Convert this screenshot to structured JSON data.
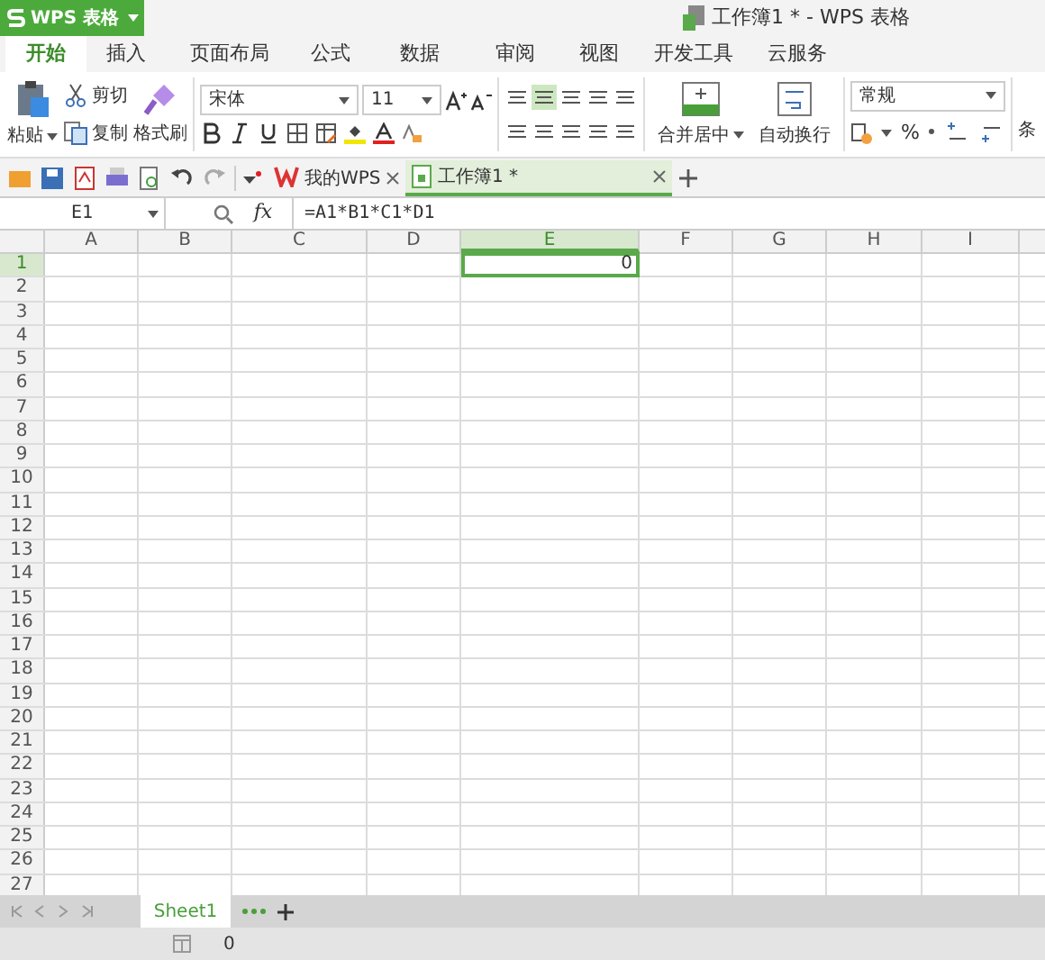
{
  "app_menu": {
    "label": "WPS 表格"
  },
  "window": {
    "title": "工作簿1 * - WPS 表格"
  },
  "ribbon_tabs": [
    {
      "label": "开始",
      "selected": true
    },
    {
      "label": "插入",
      "selected": false
    },
    {
      "label": "页面布局",
      "selected": false
    },
    {
      "label": "公式",
      "selected": false
    },
    {
      "label": "数据",
      "selected": false
    },
    {
      "label": "审阅",
      "selected": false
    },
    {
      "label": "视图",
      "selected": false
    },
    {
      "label": "开发工具",
      "selected": false
    },
    {
      "label": "云服务",
      "selected": false
    }
  ],
  "ribbon": {
    "paste": "粘贴",
    "cut": "剪切",
    "copy": "复制",
    "format_painter": "格式刷",
    "font_name": "宋体",
    "font_size": "11",
    "merge": "合并居中",
    "wrap": "自动换行",
    "number_format": "常规",
    "percent": "%",
    "cut_off_label": "条"
  },
  "doc_tabs": [
    {
      "label": "我的WPS",
      "selected": false
    },
    {
      "label": "工作簿1 *",
      "selected": true
    }
  ],
  "formula_bar": {
    "name_box": "E1",
    "fx": "fx",
    "formula": "=A1*B1*C1*D1"
  },
  "grid": {
    "columns": [
      {
        "label": "A",
        "selected": false
      },
      {
        "label": "B",
        "selected": false
      },
      {
        "label": "C",
        "selected": false
      },
      {
        "label": "D",
        "selected": false
      },
      {
        "label": "E",
        "selected": true
      },
      {
        "label": "F",
        "selected": false
      },
      {
        "label": "G",
        "selected": false
      },
      {
        "label": "H",
        "selected": false
      },
      {
        "label": "I",
        "selected": false
      }
    ],
    "rows": [
      {
        "label": "1",
        "selected": true,
        "cells": {
          "E": "0"
        }
      },
      {
        "label": "2",
        "selected": false
      },
      {
        "label": "3",
        "selected": false
      },
      {
        "label": "4",
        "selected": false
      },
      {
        "label": "5",
        "selected": false
      },
      {
        "label": "6",
        "selected": false
      },
      {
        "label": "7",
        "selected": false
      },
      {
        "label": "8",
        "selected": false
      },
      {
        "label": "9",
        "selected": false
      },
      {
        "label": "10",
        "selected": false
      },
      {
        "label": "11",
        "selected": false
      },
      {
        "label": "12",
        "selected": false
      },
      {
        "label": "13",
        "selected": false
      },
      {
        "label": "14",
        "selected": false
      },
      {
        "label": "15",
        "selected": false
      },
      {
        "label": "16",
        "selected": false
      },
      {
        "label": "17",
        "selected": false
      },
      {
        "label": "18",
        "selected": false
      },
      {
        "label": "19",
        "selected": false
      },
      {
        "label": "20",
        "selected": false
      },
      {
        "label": "21",
        "selected": false
      },
      {
        "label": "22",
        "selected": false
      },
      {
        "label": "23",
        "selected": false
      },
      {
        "label": "24",
        "selected": false
      },
      {
        "label": "25",
        "selected": false
      },
      {
        "label": "26",
        "selected": false
      },
      {
        "label": "27",
        "selected": false
      }
    ]
  },
  "sheet_tabs": [
    {
      "label": "Sheet1",
      "selected": true
    }
  ],
  "status_bar": {
    "value": "0"
  }
}
